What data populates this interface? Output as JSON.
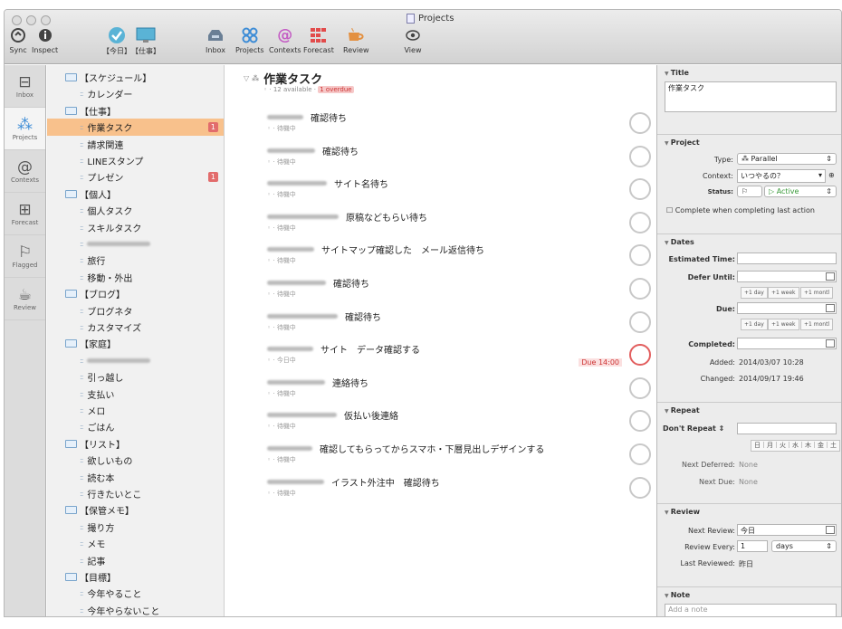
{
  "window": {
    "title": "Projects"
  },
  "toolbar": {
    "items": [
      {
        "label": "Sync",
        "icon": "sync-icon"
      },
      {
        "label": "Inspect",
        "icon": "inspect-icon"
      },
      {
        "label": "【今日】",
        "icon": "check-perspective-icon"
      },
      {
        "label": "【仕事】",
        "icon": "monitor-perspective-icon"
      },
      {
        "label": "Inbox",
        "icon": "inbox-icon"
      },
      {
        "label": "Projects",
        "icon": "projects-icon"
      },
      {
        "label": "Contexts",
        "icon": "contexts-icon"
      },
      {
        "label": "Forecast",
        "icon": "forecast-icon"
      },
      {
        "label": "Review",
        "icon": "review-icon"
      },
      {
        "label": "View",
        "icon": "view-icon"
      }
    ]
  },
  "tabs": [
    {
      "label": "Inbox",
      "icon": "inbox-tab-icon"
    },
    {
      "label": "Projects",
      "icon": "projects-tab-icon"
    },
    {
      "label": "Contexts",
      "icon": "contexts-tab-icon"
    },
    {
      "label": "Forecast",
      "icon": "forecast-tab-icon"
    },
    {
      "label": "Flagged",
      "icon": "flag-icon"
    },
    {
      "label": "Review",
      "icon": "review-tab-icon"
    }
  ],
  "sidebar": {
    "items": [
      {
        "type": "folder",
        "label": "【スケジュール】"
      },
      {
        "type": "project",
        "label": "カレンダー"
      },
      {
        "type": "folder",
        "label": "【仕事】"
      },
      {
        "type": "project",
        "label": "作業タスク",
        "badge": "1",
        "selected": true
      },
      {
        "type": "project",
        "label": "請求関連"
      },
      {
        "type": "project",
        "label": "LINEスタンプ"
      },
      {
        "type": "project",
        "label": "プレゼン",
        "badge": "1"
      },
      {
        "type": "folder",
        "label": "【個人】"
      },
      {
        "type": "project",
        "label": "個人タスク"
      },
      {
        "type": "project",
        "label": "スキルタスク"
      },
      {
        "type": "project",
        "label": "",
        "blurred": true
      },
      {
        "type": "project",
        "label": "旅行"
      },
      {
        "type": "project",
        "label": "移動・外出"
      },
      {
        "type": "folder",
        "label": "【ブログ】"
      },
      {
        "type": "project",
        "label": "ブログネタ"
      },
      {
        "type": "project",
        "label": "カスタマイズ"
      },
      {
        "type": "folder",
        "label": "【家庭】"
      },
      {
        "type": "project",
        "label": "",
        "blurred": true
      },
      {
        "type": "project",
        "label": "引っ越し"
      },
      {
        "type": "project",
        "label": "支払い"
      },
      {
        "type": "project",
        "label": "メロ"
      },
      {
        "type": "project",
        "label": "ごはん"
      },
      {
        "type": "folder",
        "label": "【リスト】"
      },
      {
        "type": "project",
        "label": "欲しいもの"
      },
      {
        "type": "project",
        "label": "読む本"
      },
      {
        "type": "project",
        "label": "行きたいとこ"
      },
      {
        "type": "folder",
        "label": "【保管メモ】"
      },
      {
        "type": "project",
        "label": "撮り方"
      },
      {
        "type": "project",
        "label": "メモ"
      },
      {
        "type": "project",
        "label": "記事"
      },
      {
        "type": "folder",
        "label": "【目標】"
      },
      {
        "type": "project",
        "label": "今年やること"
      },
      {
        "type": "project",
        "label": "今年やらないこと"
      }
    ]
  },
  "main": {
    "title": "作業タスク",
    "available": "12 available",
    "overdue": "1 overdue",
    "tasks": [
      {
        "title": "確認待ち",
        "context": "待機中"
      },
      {
        "title": "確認待ち",
        "context": "待機中"
      },
      {
        "title": "サイト名待ち",
        "context": "待機中"
      },
      {
        "title": "原稿などもらい待ち",
        "context": "待機中"
      },
      {
        "title": "サイトマップ確認した　メール返信待ち",
        "context": "待機中"
      },
      {
        "title": "確認待ち",
        "context": "待機中"
      },
      {
        "title": "確認待ち",
        "context": "待機中"
      },
      {
        "title": "サイト　データ確認する",
        "context": "今日中",
        "due": "Due 14:00"
      },
      {
        "title": "連絡待ち",
        "context": "待機中"
      },
      {
        "title": "仮払い後連絡",
        "context": "待機中"
      },
      {
        "title": "確認してもらってからスマホ・下層見出しデザインする",
        "context": "待機中"
      },
      {
        "title": "イラスト外注中　確認待ち",
        "context": "待機中"
      }
    ]
  },
  "inspector": {
    "title_section": {
      "header": "Title",
      "value": "作業タスク"
    },
    "project": {
      "header": "Project",
      "type_label": "Type:",
      "type_value": "Parallel",
      "context_label": "Context:",
      "context_value": "いつやるの？",
      "status_label": "Status:",
      "status_value": "Active",
      "complete_label": "Complete when completing last action"
    },
    "dates": {
      "header": "Dates",
      "estimated_label": "Estimated Time:",
      "defer_label": "Defer Until:",
      "due_label": "Due:",
      "completed_label": "Completed:",
      "added_label": "Added:",
      "added_value": "2014/03/07 10:28",
      "changed_label": "Changed:",
      "changed_value": "2014/09/17 19:46",
      "btn_day": "+1 day",
      "btn_week": "+1 week",
      "btn_month": "+1 montl"
    },
    "repeat": {
      "header": "Repeat",
      "dont_repeat": "Don't Repeat",
      "weekdays": "日｜月｜火｜水｜木｜金｜土",
      "next_deferred_label": "Next Deferred:",
      "next_deferred_value": "None",
      "next_due_label": "Next Due:",
      "next_due_value": "None"
    },
    "review": {
      "header": "Review",
      "next_label": "Next Review:",
      "next_value": "今日",
      "every_label": "Review Every:",
      "every_value": "1",
      "every_unit": "days",
      "last_label": "Last Reviewed:",
      "last_value": "昨日"
    },
    "note": {
      "header": "Note",
      "placeholder": "Add a note"
    }
  }
}
